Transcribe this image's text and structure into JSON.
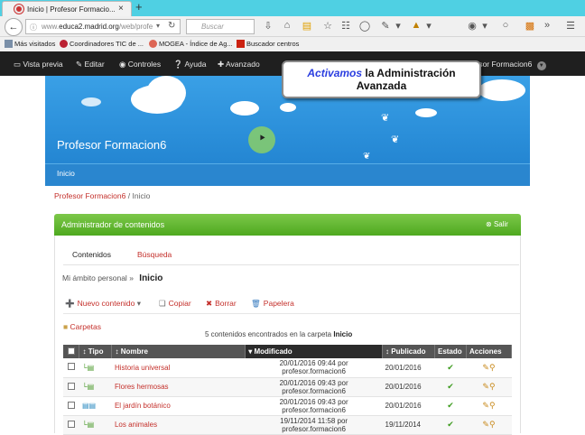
{
  "browser": {
    "tab_title": "Inicio | Profesor Formacio...",
    "new_tab": "+",
    "close_tab": "×",
    "url_prefix": "www.",
    "url_domain": "educa2.madrid.org",
    "url_path": "/web/profe",
    "search_placeholder": "Buscar",
    "bookmarks": [
      "Más visitados",
      "Coordinadores TIC de ...",
      "MOGEA - Índice de Ag...",
      "Buscador centros"
    ]
  },
  "dockbar": {
    "items": [
      "Vista previa",
      "Editar",
      "Controles",
      "Ayuda",
      "Avanzado"
    ],
    "user": "Profesor Formacion6"
  },
  "callout": {
    "highlight": "Activamos",
    "rest_line1": " la Administración",
    "line2": "Avanzada"
  },
  "site": {
    "title": "Profesor Formacion6",
    "nav_item": "Inicio",
    "breadcrumb_link": "Profesor Formacion6",
    "breadcrumb_sep": " / ",
    "breadcrumb_current": "Inicio"
  },
  "portlet": {
    "title": "Administrador de contenidos",
    "exit": "Salir",
    "tabs": [
      "Contenidos",
      "Búsqueda"
    ],
    "scope_label": "Mi ámbito personal",
    "scope_sep": "»",
    "scope_current": "Inicio",
    "tools": [
      "Nuevo contenido",
      "Copiar",
      "Borrar",
      "Papelera"
    ],
    "folders": "Carpetas",
    "count_text": "5 contenidos encontrados en la carpeta",
    "count_folder": "Inicio"
  },
  "table": {
    "headers": [
      "Tipo",
      "Nombre",
      "Modificado",
      "Publicado",
      "Estado",
      "Acciones"
    ],
    "rows": [
      {
        "name": "Historia universal",
        "modified": "20/01/2016 09:44 por",
        "modified_by": "profesor.formacion6",
        "published": "20/01/2016"
      },
      {
        "name": "Flores hermosas",
        "modified": "20/01/2016 09:43 por",
        "modified_by": "profesor.formacion6",
        "published": "20/01/2016"
      },
      {
        "name": "El jardín botánico",
        "modified": "20/01/2016 09:43 por",
        "modified_by": "profesor.formacion6",
        "published": "20/01/2016"
      },
      {
        "name": "Los animales",
        "modified": "19/11/2014 11:58 por",
        "modified_by": "profesor.formacion6",
        "published": "19/11/2014"
      }
    ]
  },
  "colors": {
    "accent_red": "#c4302b",
    "portlet_green": "#4ea91f",
    "banner_blue": "#2a8ed9",
    "dockbar": "#1f1f1f"
  }
}
